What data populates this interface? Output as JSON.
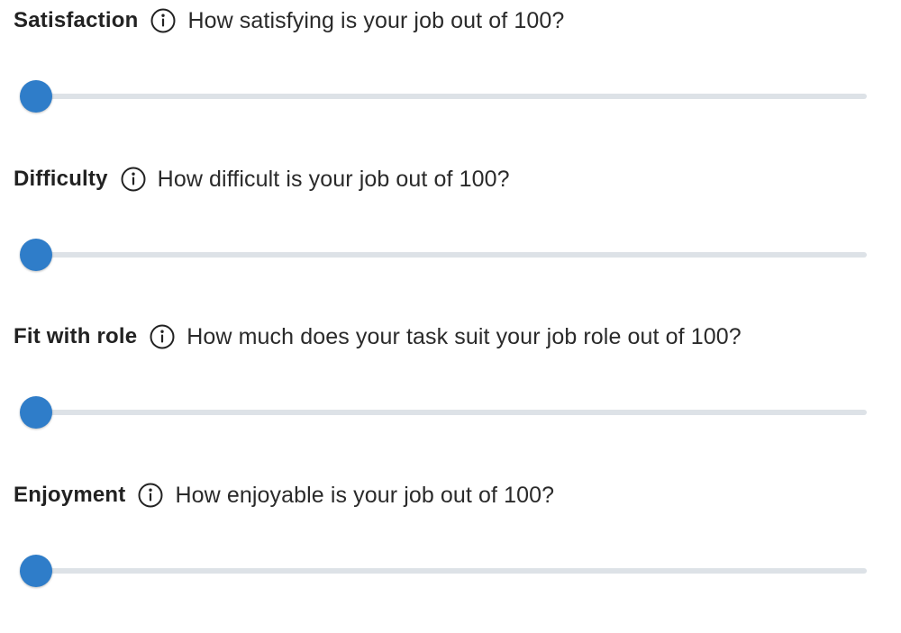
{
  "colors": {
    "accent": "#2f7dc9",
    "track": "#dde2e7",
    "text": "#222222"
  },
  "questions": [
    {
      "title": "Satisfaction",
      "icon": "info-icon",
      "prompt": "How satisfying is your job out of 100?",
      "value": 0,
      "min": 0,
      "max": 100
    },
    {
      "title": "Difficulty",
      "icon": "info-icon",
      "prompt": "How difficult is your job out of 100?",
      "value": 0,
      "min": 0,
      "max": 100
    },
    {
      "title": "Fit with role",
      "icon": "info-icon",
      "prompt": "How much does your task suit your job role out of 100?",
      "value": 0,
      "min": 0,
      "max": 100
    },
    {
      "title": "Enjoyment",
      "icon": "info-icon",
      "prompt": "How enjoyable is your job out of 100?",
      "value": 0,
      "min": 0,
      "max": 100
    }
  ]
}
